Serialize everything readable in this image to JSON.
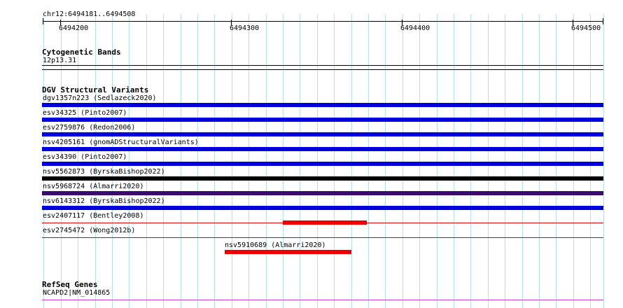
{
  "ruler": {
    "location": "chr12:6494181..6494508",
    "ticks": [
      "6494200",
      "6494300",
      "6494400",
      "6494500"
    ]
  },
  "cytobands": {
    "title": "Cytogenetic Bands",
    "band": "12p13.31"
  },
  "dgv": {
    "title": "DGV Structural Variants",
    "variants": [
      {
        "label": "dgv1357n223 (Sedlazeck2020)",
        "color": "#0000dd"
      },
      {
        "label": "esv34325 (Pinto2007)",
        "color": "#0000dd"
      },
      {
        "label": "esv2759876 (Redon2006)",
        "color": "#0000dd"
      },
      {
        "label": "nsv4205161 (gnomADStructuralVariants)",
        "color": "#0000dd"
      },
      {
        "label": "esv34390 (Pinto2007)",
        "color": "#0000dd"
      },
      {
        "label": "nsv5562873 (ByrskaBishop2022)",
        "color": "#000000"
      },
      {
        "label": "nsv5968724 (Almarri2020)",
        "color": "#3a0a6e"
      },
      {
        "label": "nsv6143312 (ByrskaBishop2022)",
        "color": "#0000dd"
      },
      {
        "label": "esv2407117 (Bentley2008)",
        "color": "#dd0000"
      },
      {
        "label": "esv2745472 (Wong2012b)",
        "color": "#dd0000"
      },
      {
        "label": "nsv5910689 (Almarri2020)",
        "color": "#dd0000"
      }
    ]
  },
  "refseq": {
    "title": "RefSeq Genes",
    "gene": "NCAPD2|NM_014865",
    "color": "#cc44cc"
  }
}
